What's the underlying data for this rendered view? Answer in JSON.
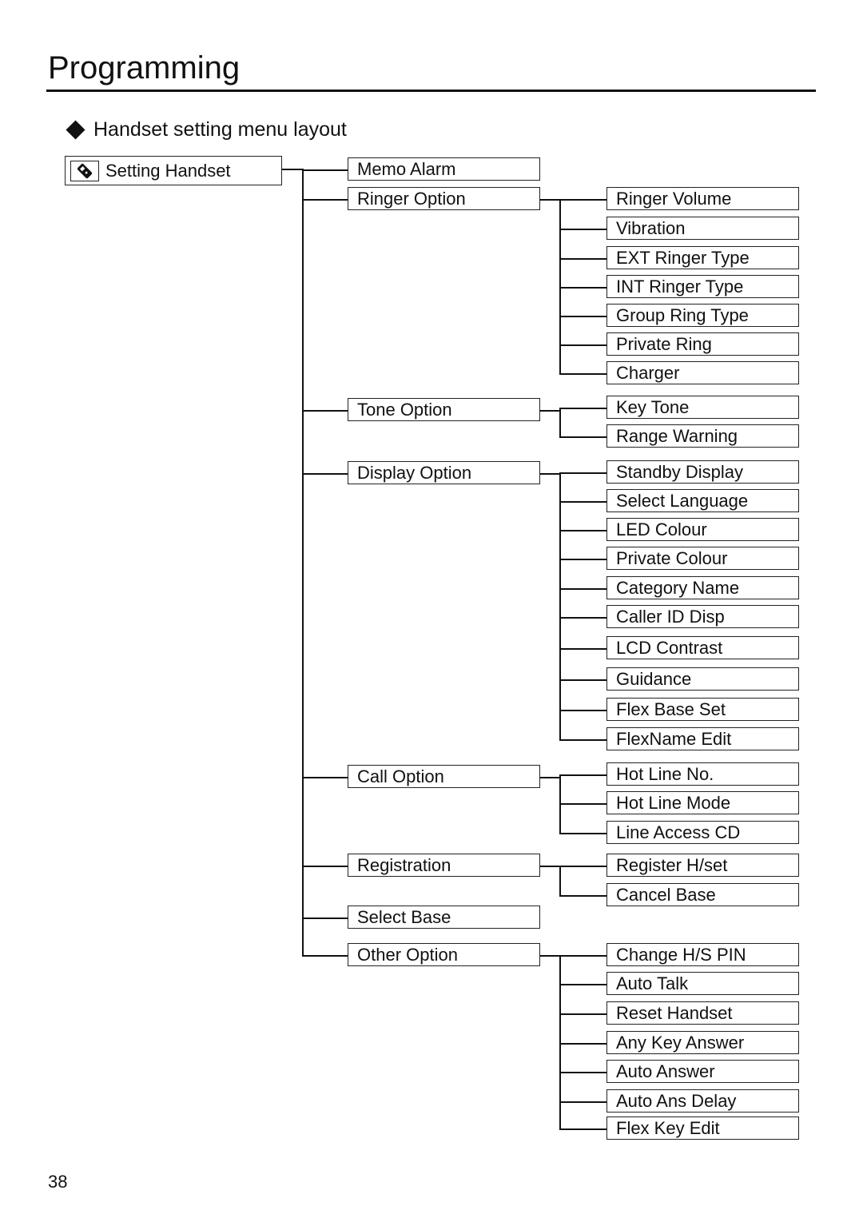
{
  "page": {
    "title": "Programming",
    "section_heading": "Handset setting menu layout",
    "page_number": "38"
  },
  "menu": {
    "root": {
      "label": "Setting Handset",
      "icon": "handset-edit-icon"
    },
    "items": [
      {
        "label": "Memo Alarm",
        "children": []
      },
      {
        "label": "Ringer Option",
        "children": [
          "Ringer Volume",
          "Vibration",
          "EXT Ringer Type",
          "INT Ringer Type",
          "Group Ring Type",
          "Private Ring",
          "Charger"
        ]
      },
      {
        "label": "Tone Option",
        "children": [
          "Key Tone",
          "Range Warning"
        ]
      },
      {
        "label": "Display Option",
        "children": [
          "Standby Display",
          "Select Language",
          "LED Colour",
          "Private Colour",
          "Category Name",
          "Caller ID Disp",
          "LCD Contrast",
          "Guidance",
          "Flex Base Set",
          "FlexName Edit"
        ]
      },
      {
        "label": "Call Option",
        "children": [
          "Hot Line No.",
          "Hot Line Mode",
          "Line Access CD"
        ]
      },
      {
        "label": "Registration",
        "children": [
          "Register H/set",
          "Cancel Base"
        ]
      },
      {
        "label": "Select Base",
        "children": []
      },
      {
        "label": "Other Option",
        "children": [
          "Change H/S PIN",
          "Auto Talk",
          "Reset Handset",
          "Any Key Answer",
          "Auto Answer",
          "Auto Ans Delay",
          "Flex Key Edit"
        ]
      }
    ]
  }
}
